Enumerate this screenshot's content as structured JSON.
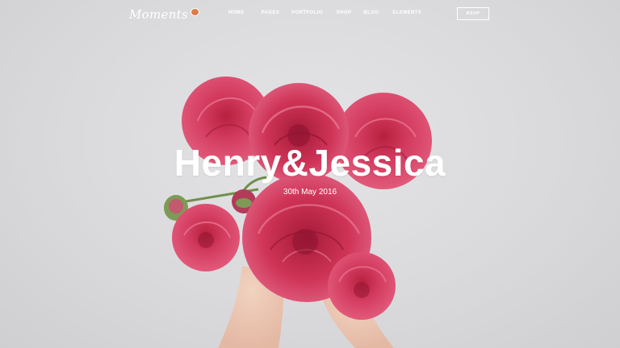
{
  "brand": {
    "logo_text": "Moments"
  },
  "nav": {
    "items": [
      {
        "label": "HOME"
      },
      {
        "label": "PAGES"
      },
      {
        "label": "PORTFOLIO"
      },
      {
        "label": "SHOP"
      },
      {
        "label": "BLOG"
      },
      {
        "label": "ELEMENTS"
      }
    ],
    "cta_label": "RSVP"
  },
  "hero": {
    "title": "Henry&Jessica",
    "date": "30th May 2016"
  },
  "colors": {
    "background": "#d8d8da",
    "flower_pink": "#d23a5e",
    "text": "#ffffff"
  }
}
